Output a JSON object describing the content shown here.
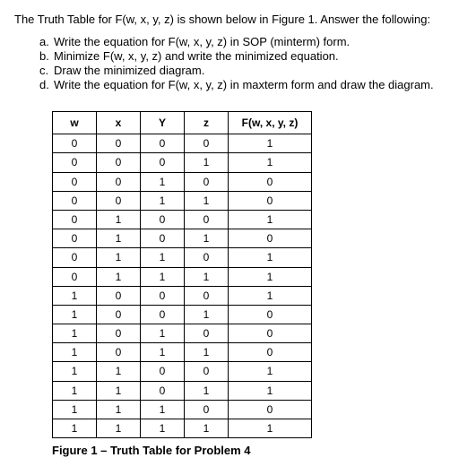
{
  "intro": "The Truth Table for F(w, x, y, z) is shown below in Figure 1. Answer the following:",
  "questions": [
    {
      "letter": "a.",
      "text": "Write the equation for F(w, x, y, z) in SOP (minterm) form."
    },
    {
      "letter": "b.",
      "text": "Minimize F(w, x, y, z) and write the minimized equation."
    },
    {
      "letter": "c.",
      "text": "Draw the minimized diagram."
    },
    {
      "letter": "d.",
      "text": "Write the equation for F(w, x, y, z) in maxterm form and draw the diagram."
    }
  ],
  "table": {
    "headers": [
      "w",
      "x",
      "Y",
      "z",
      "F(w, x, y, z)"
    ],
    "rows": [
      [
        "0",
        "0",
        "0",
        "0",
        "1"
      ],
      [
        "0",
        "0",
        "0",
        "1",
        "1"
      ],
      [
        "0",
        "0",
        "1",
        "0",
        "0"
      ],
      [
        "0",
        "0",
        "1",
        "1",
        "0"
      ],
      [
        "0",
        "1",
        "0",
        "0",
        "1"
      ],
      [
        "0",
        "1",
        "0",
        "1",
        "0"
      ],
      [
        "0",
        "1",
        "1",
        "0",
        "1"
      ],
      [
        "0",
        "1",
        "1",
        "1",
        "1"
      ],
      [
        "1",
        "0",
        "0",
        "0",
        "1"
      ],
      [
        "1",
        "0",
        "0",
        "1",
        "0"
      ],
      [
        "1",
        "0",
        "1",
        "0",
        "0"
      ],
      [
        "1",
        "0",
        "1",
        "1",
        "0"
      ],
      [
        "1",
        "1",
        "0",
        "0",
        "1"
      ],
      [
        "1",
        "1",
        "0",
        "1",
        "1"
      ],
      [
        "1",
        "1",
        "1",
        "0",
        "0"
      ],
      [
        "1",
        "1",
        "1",
        "1",
        "1"
      ]
    ]
  },
  "caption": "Figure 1 – Truth Table for Problem 4"
}
